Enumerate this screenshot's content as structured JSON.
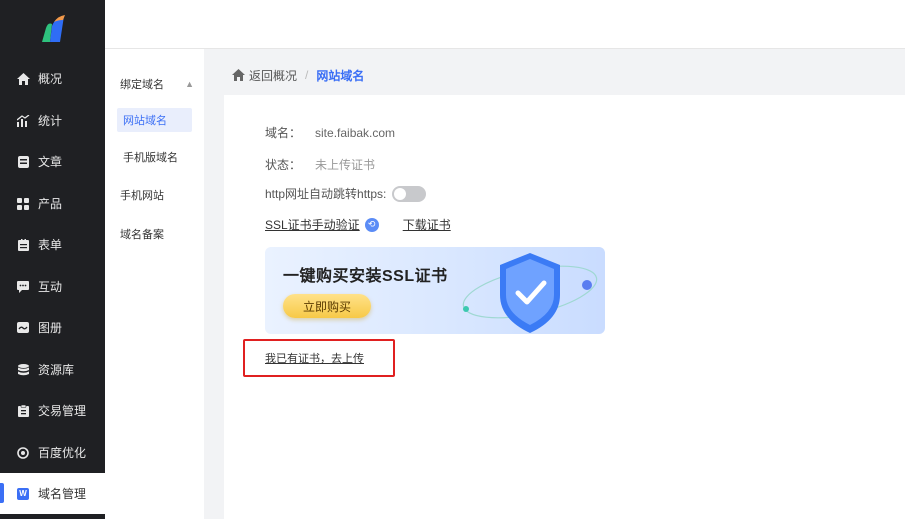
{
  "sidebar": {
    "items": [
      {
        "label": "概况",
        "icon": "home-icon"
      },
      {
        "label": "统计",
        "icon": "chart-icon"
      },
      {
        "label": "文章",
        "icon": "document-icon"
      },
      {
        "label": "产品",
        "icon": "grid-icon"
      },
      {
        "label": "表单",
        "icon": "form-icon"
      },
      {
        "label": "互动",
        "icon": "chat-icon"
      },
      {
        "label": "图册",
        "icon": "album-icon"
      },
      {
        "label": "资源库",
        "icon": "database-icon"
      },
      {
        "label": "交易管理",
        "icon": "trade-icon"
      },
      {
        "label": "百度优化",
        "icon": "target-icon"
      },
      {
        "label": "域名管理",
        "icon": "w-badge-icon",
        "badge": "W"
      }
    ]
  },
  "submenu": {
    "group": "绑定域名",
    "children": [
      "网站域名",
      "手机版域名"
    ],
    "others": [
      "手机网站",
      "域名备案"
    ]
  },
  "breadcrumb": {
    "back": "返回概况",
    "separator": "/",
    "current": "网站域名"
  },
  "domain": {
    "domain_label": "域名：",
    "domain_value": "site.faibak.com",
    "status_label": "状态：",
    "status_value": "未上传证书",
    "redirect_label": "http网址自动跳转https:",
    "redirect_enabled": false,
    "manual_verify": "SSL证书手动验证",
    "download": "下载证书"
  },
  "banner": {
    "title": "一键购买安装SSL证书",
    "button": "立即购买"
  },
  "upload": {
    "label": "我已有证书，去上传"
  },
  "colors": {
    "accent": "#3b6ff5",
    "sidebar_bg": "#1f2023",
    "highlight_border": "#e02020",
    "button_yellow": "#f7c947"
  }
}
